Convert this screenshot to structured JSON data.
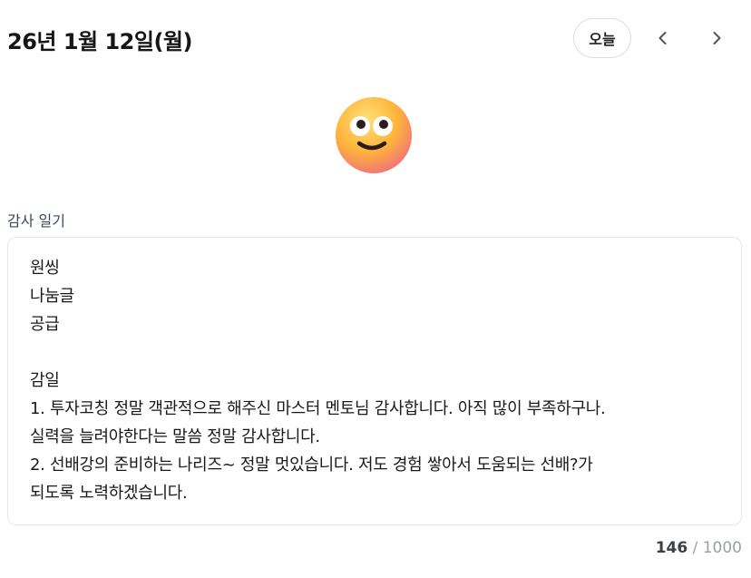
{
  "header": {
    "date": "26년 1월 12일(월)",
    "today_label": "오늘",
    "prev_icon": "chevron-left-icon",
    "next_icon": "chevron-right-icon"
  },
  "mood": {
    "icon": "smiling-face-emoji-icon"
  },
  "diary": {
    "section_label": "감사 일기",
    "content": "원씽\n나눔글\n공급\n\n감일\n1. 투자코칭 정말 객관적으로 해주신 마스터 멘토님 감사합니다. 아직 많이 부족하구나.\n실력을 늘려야한다는 말씀 정말 감사합니다.\n2. 선배강의 준비하는 나리즈~ 정말 멋있습니다. 저도 경험 쌓아서 도움되는 선배?가\n되도록 노력하겠습니다.",
    "char_count": "146",
    "separator": " / ",
    "char_limit": "1000"
  },
  "colors": {
    "label": "#3a4a5c",
    "border": "#e8e8ec",
    "counter": "#9aa0a6",
    "emoji_face": "#ffb43a"
  }
}
